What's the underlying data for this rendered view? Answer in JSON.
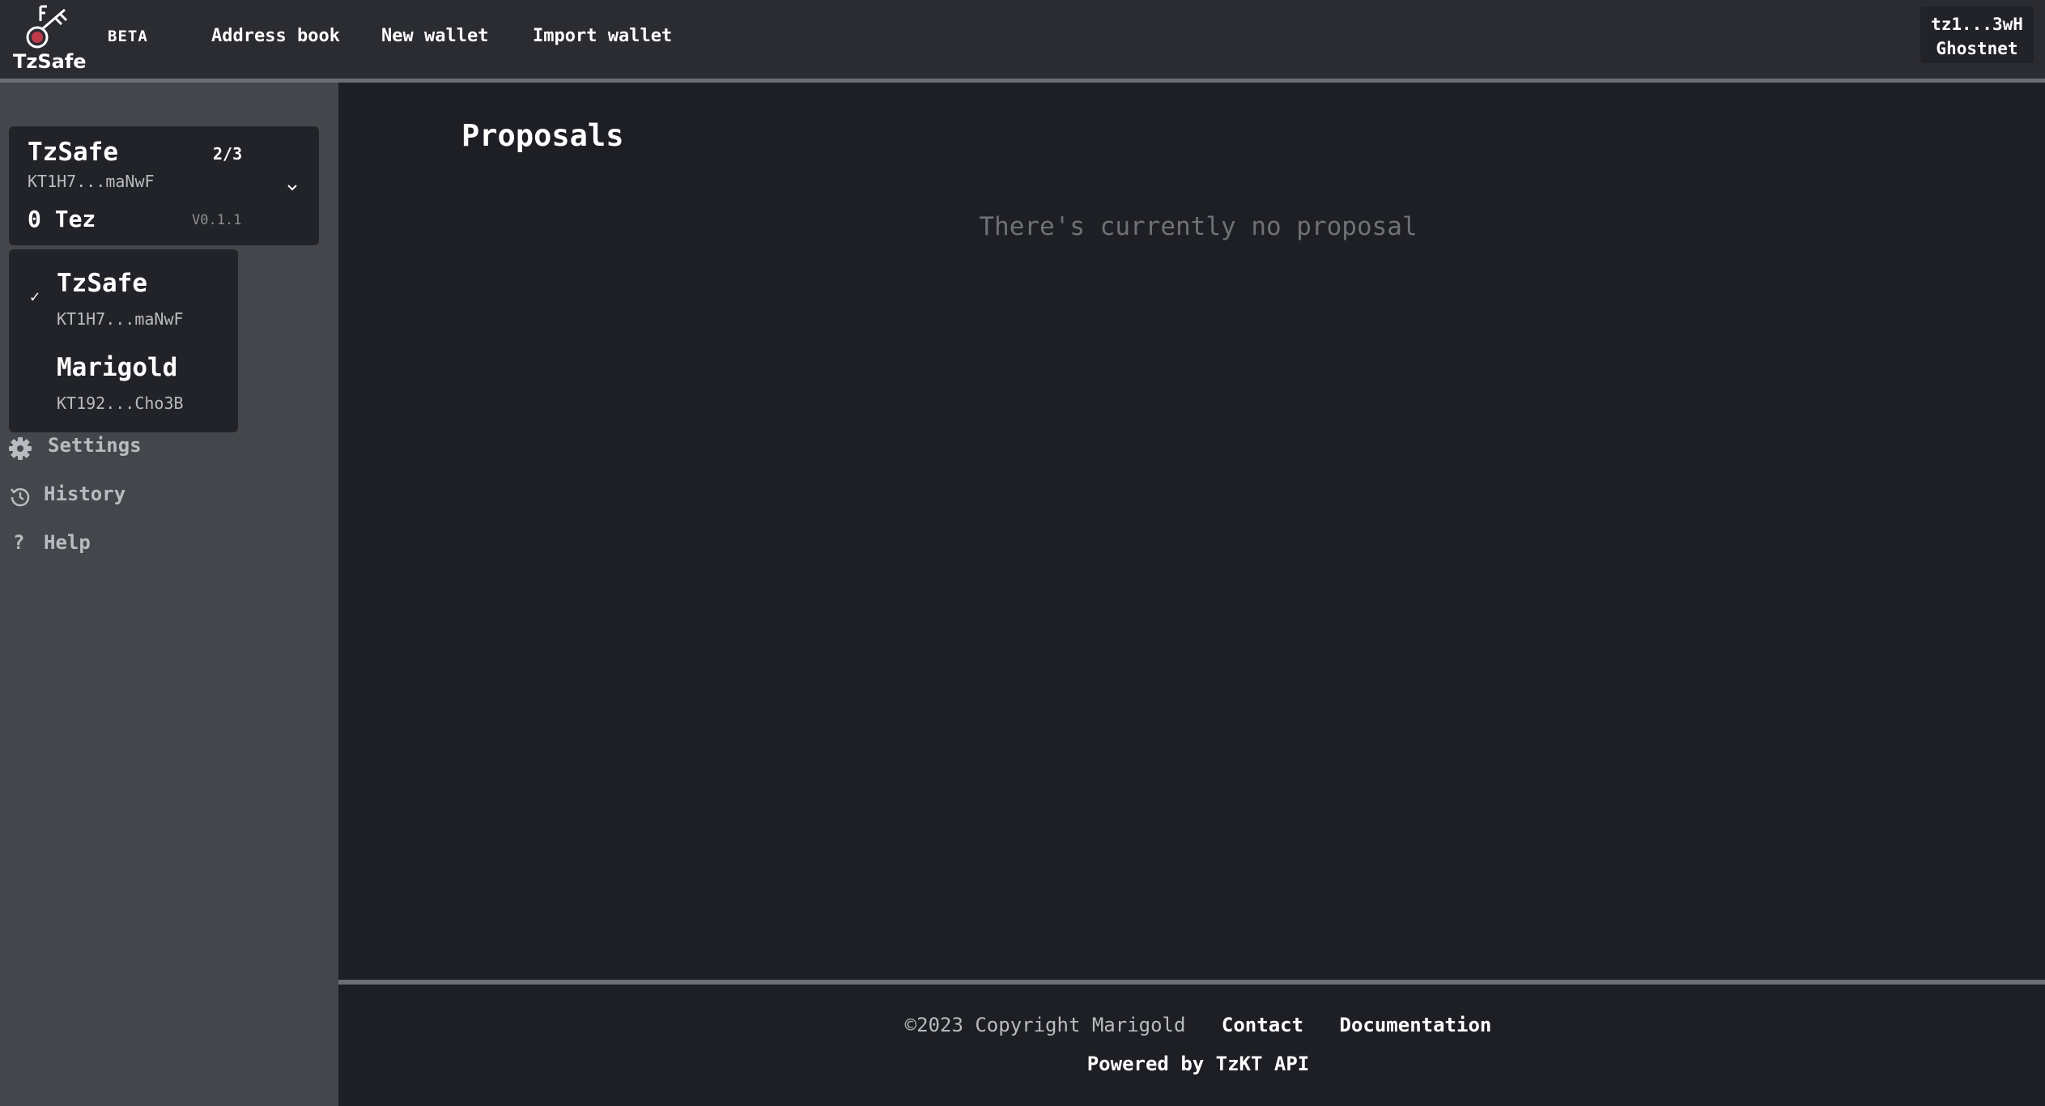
{
  "header": {
    "logo_text": "TzSafe",
    "beta": "BETA",
    "nav": [
      "Address book",
      "New wallet",
      "Import wallet"
    ],
    "account": {
      "address": "tz1...3wH",
      "network": "Ghostnet"
    }
  },
  "wallet": {
    "name": "TzSafe",
    "threshold": "2/3",
    "address": "KT1H7...maNwF",
    "balance": "0 Tez",
    "version": "V0.1.1"
  },
  "dropdown": {
    "items": [
      {
        "name": "TzSafe",
        "address": "KT1H7...maNwF",
        "check": "✓"
      },
      {
        "name": "Marigold",
        "address": "KT192...Cho3B"
      }
    ]
  },
  "sidebar": {
    "links": [
      "Settings",
      "History",
      "Help"
    ],
    "help_icon": "?"
  },
  "main": {
    "title": "Proposals",
    "empty_message": "There's currently no proposal"
  },
  "footer": {
    "copyright": "©2023 Copyright Marigold",
    "contact": "Contact",
    "documentation": "Documentation",
    "powered_by": "Powered by TzKT API"
  }
}
